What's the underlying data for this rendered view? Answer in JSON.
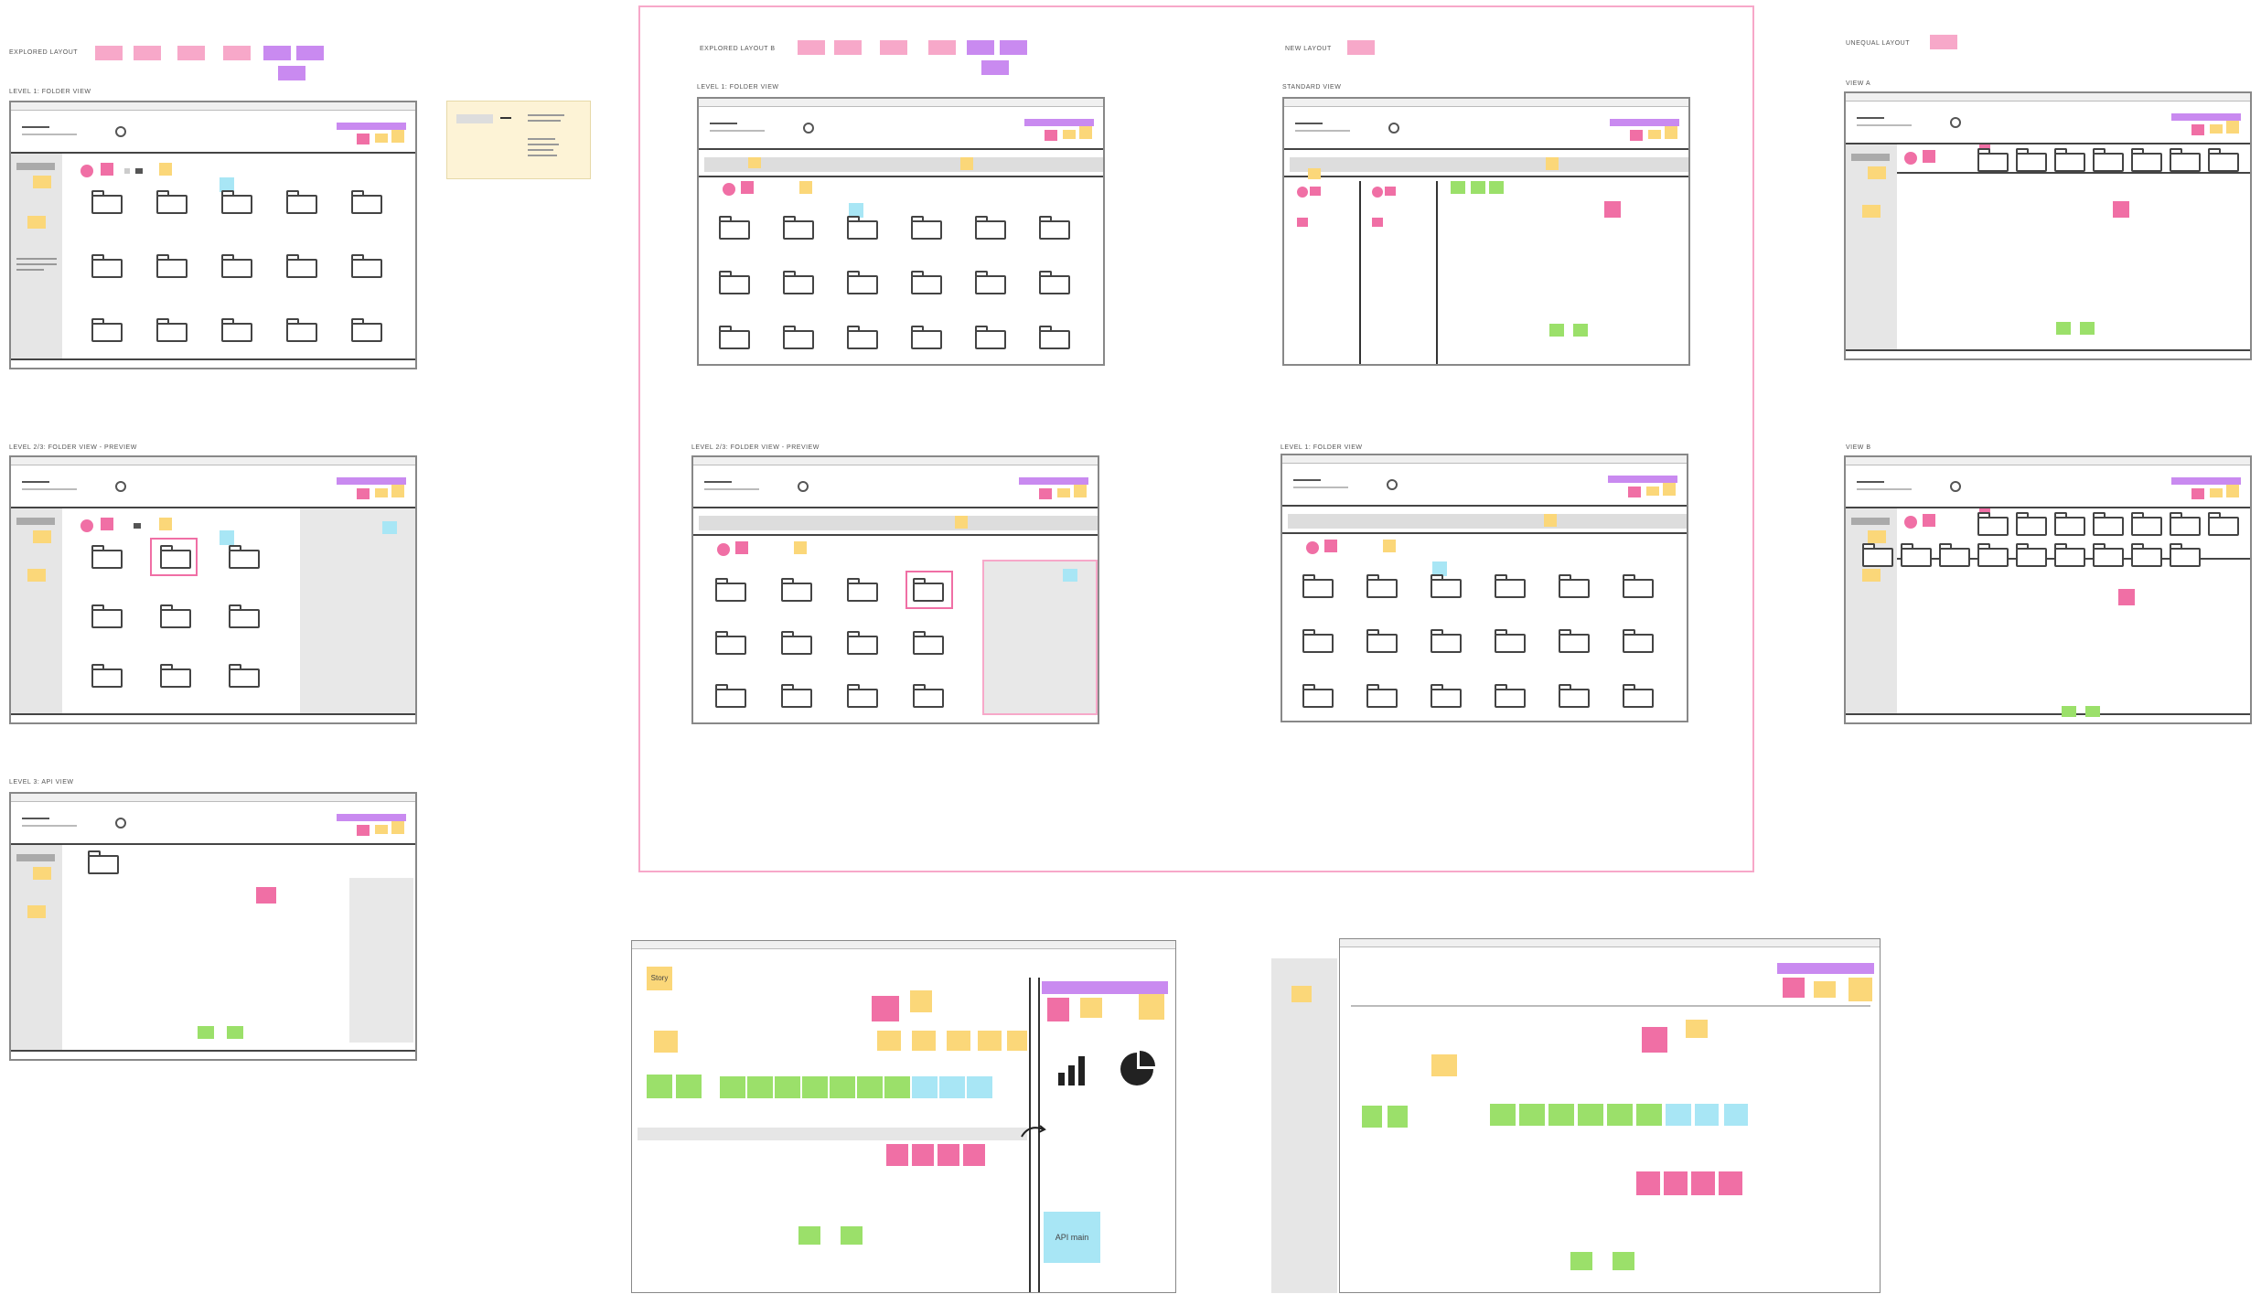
{
  "headings": {
    "h_explored_a": "EXPLORED LAYOUT",
    "h_explored_b": "EXPLORED LAYOUT B",
    "h_new": "NEW LAYOUT",
    "h_unequal": "UNEQUAL LAYOUT",
    "h_lvl1_a": "LEVEL 1: FOLDER VIEW",
    "h_lvl1_b": "LEVEL 1: FOLDER VIEW",
    "h_standard": "STANDARD VIEW",
    "h_lvl1_c": "LEVEL 1: FOLDER VIEW",
    "h_view_a": "VIEW A",
    "h_view_b": "VIEW B",
    "h_lvl2_a": "LEVEL 2/3: FOLDER VIEW - PREVIEW",
    "h_lvl2_b": "LEVEL 2/3: FOLDER VIEW - PREVIEW",
    "h_lvl3": "LEVEL 3: API VIEW"
  },
  "bottom": {
    "story": "Story",
    "api_main": "API main"
  },
  "colors": {
    "pink": "#f06fa5",
    "purple": "#c98af0",
    "yellow": "#fbd779",
    "green": "#9be06a",
    "blue": "#a8e6f5",
    "frame_border": "#f7a8c9"
  },
  "icons": [
    "folder-icon",
    "search-icon",
    "bar-chart-icon",
    "pie-chart-icon",
    "arrow-icon"
  ]
}
